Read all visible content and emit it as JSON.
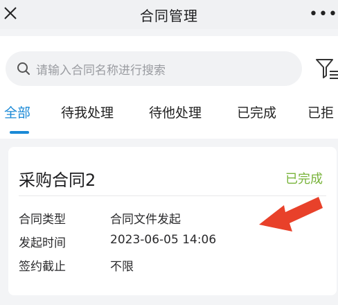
{
  "header": {
    "title": "合同管理",
    "close_icon": "close-icon",
    "more_icon": "more-icon"
  },
  "search": {
    "placeholder": "请输入合同名称进行搜索",
    "icon": "search-icon"
  },
  "filter": {
    "icon": "filter-icon"
  },
  "tabs": [
    {
      "label": "全部",
      "active": true
    },
    {
      "label": "待我处理",
      "active": false
    },
    {
      "label": "待他处理",
      "active": false
    },
    {
      "label": "已完成",
      "active": false
    },
    {
      "label": "已拒",
      "active": false
    }
  ],
  "contract": {
    "title": "采购合同2",
    "status": "已完成",
    "fields": [
      {
        "label": "合同类型",
        "value": "合同文件发起"
      },
      {
        "label": "发起时间",
        "value": "2023-06-05 14:06"
      },
      {
        "label": "签约截止",
        "value": "不限"
      }
    ]
  },
  "annotation": {
    "icon": "red-arrow-icon"
  },
  "colors": {
    "accent": "#1a89d6",
    "status_done": "#78b33a",
    "annotation": "#e8412a"
  }
}
